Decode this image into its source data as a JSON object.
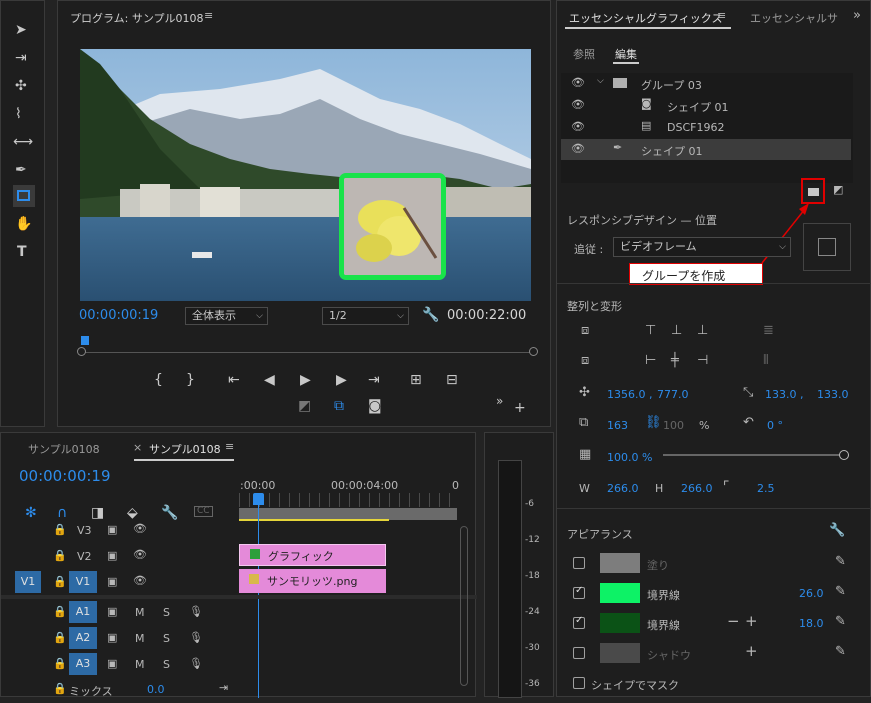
{
  "program_monitor": {
    "title": "プログラム: サンプル0108",
    "current_time": "00:00:00:19",
    "fit_select": "全体表示",
    "resolution_select": "1/2",
    "duration": "00:00:22:00"
  },
  "essential_graphics": {
    "tab_active": "エッセンシャルグラフィックス",
    "tab_inactive": "エッセンシャルサ",
    "subtab_browse": "参照",
    "subtab_edit": "編集",
    "layers": [
      {
        "label": "グループ 03"
      },
      {
        "label": "シェイプ 01"
      },
      {
        "label": "DSCF1962"
      },
      {
        "label": "シェイプ 01"
      }
    ],
    "callout": "グループを作成",
    "responsive_title": "レスポンシブデザイン — 位置",
    "follow_label": "追従 :",
    "follow_value": "ビデオフレーム",
    "align_title": "整列と変形",
    "position_x": "1356.0 ,",
    "position_y": "777.0",
    "anchor_x": "133.0 ,",
    "anchor_y": "133.0",
    "scale": "163",
    "scale_lock_value": "100",
    "scale_unit": "%",
    "rotation": "0 °",
    "opacity": "100.0 %",
    "w_label": "W",
    "w_value": "266.0",
    "h_label": "H",
    "h_value": "266.0",
    "corner_value": "2.5",
    "appearance_title": "アピアランス",
    "fill_label": "塗り",
    "stroke1_label": "境界線",
    "stroke1_value": "26.0",
    "stroke2_label": "境界線",
    "stroke2_value": "18.0",
    "shadow_label": "シャドウ",
    "mask_label": "シェイプでマスク",
    "colors": {
      "fill": "#7d7d7d",
      "stroke1": "#0df266",
      "stroke2": "#0b5216",
      "shadow": "#4a4a4a"
    }
  },
  "timeline": {
    "tab_inactive": "サンプル0108",
    "tab_active": "サンプル0108",
    "current_time": "00:00:00:19",
    "ruler_start": ":00:00",
    "ruler_mid": "00:00:04:00",
    "ruler_end": "0",
    "tracks": {
      "v3": "V3",
      "v2": "V2",
      "v1": "V1",
      "v1_src": "V1",
      "a1": "A1",
      "a2": "A2",
      "a3": "A3",
      "mute": "M",
      "solo": "S",
      "mix_label": "ミックス",
      "mix_value": "0.0"
    },
    "clips": {
      "graphic": "グラフィック",
      "png": "サンモリッツ.png"
    }
  },
  "meter": {
    "ticks": [
      "-6",
      "-12",
      "-18",
      "-24",
      "-30",
      "-36"
    ]
  }
}
